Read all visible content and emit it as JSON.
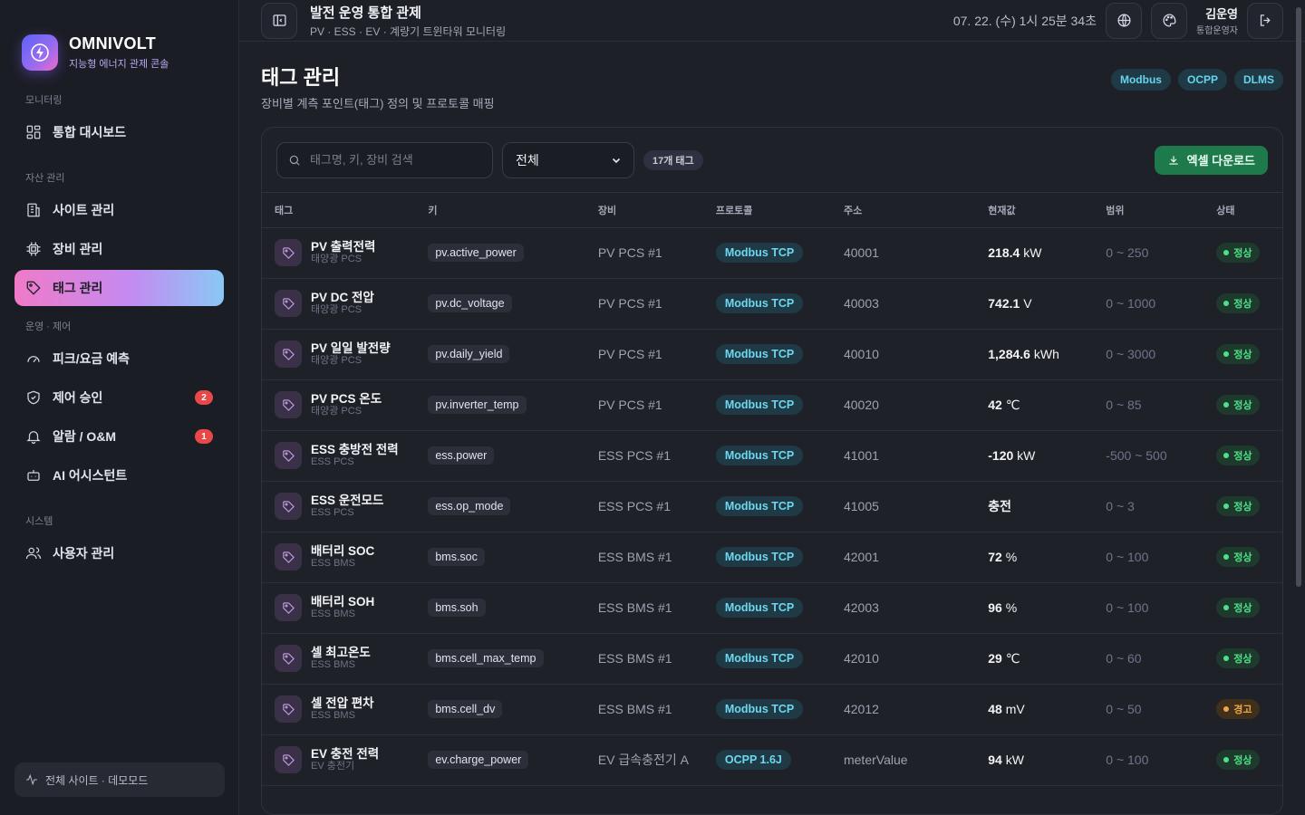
{
  "brand": {
    "name": "OMNIVOLT",
    "subtitle": "지능형 에너지 관제 콘솔"
  },
  "sidebar": {
    "sections": [
      {
        "label": "모니터링"
      },
      {
        "label": "자산 관리"
      },
      {
        "label": "운영 · 제어"
      },
      {
        "label": "시스템"
      }
    ],
    "items": [
      {
        "label": "통합 대시보드",
        "icon": "dashboard-icon"
      },
      {
        "label": "사이트 관리",
        "icon": "building-icon"
      },
      {
        "label": "장비 관리",
        "icon": "chip-icon"
      },
      {
        "label": "태그 관리",
        "icon": "tag-icon",
        "active": true
      },
      {
        "label": "피크/요금 예측",
        "icon": "gauge-icon"
      },
      {
        "label": "제어 승인",
        "icon": "shield-icon",
        "badge": "2"
      },
      {
        "label": "알람 / O&M",
        "icon": "bell-icon",
        "badge": "1"
      },
      {
        "label": "AI 어시스턴트",
        "icon": "robot-icon"
      },
      {
        "label": "사용자 관리",
        "icon": "users-icon"
      }
    ],
    "footer": "전체 사이트 · 데모모드"
  },
  "topbar": {
    "title": "발전 운영 통합 관제",
    "subtitle": "PV · ESS · EV · 계량기 트윈타워 모니터링",
    "clock": "07. 22. (수) 1시 25분 34초",
    "user_name": "김운영",
    "user_role": "통합운영자"
  },
  "page": {
    "title": "태그 관리",
    "subtitle": "장비별 계측 포인트(태그) 정의 및 프로토콜 매핑",
    "protocols": [
      "Modbus",
      "OCPP",
      "DLMS"
    ]
  },
  "toolbar": {
    "search_placeholder": "태그명, 키, 장비 검색",
    "filter_value": "전체",
    "count": "17개 태그",
    "excel_label": "엑셀 다운로드"
  },
  "table": {
    "headers": [
      "태그",
      "키",
      "장비",
      "프로토콜",
      "주소",
      "현재값",
      "범위",
      "상태"
    ],
    "rows": [
      {
        "name": "PV 출력전력",
        "device_type": "태양광 PCS",
        "key": "pv.active_power",
        "device": "PV PCS #1",
        "protocol": "Modbus TCP",
        "address": "40001",
        "value": "218.4",
        "unit": "kW",
        "range": "0 ~ 250",
        "status": "정상",
        "status_level": "ok"
      },
      {
        "name": "PV DC 전압",
        "device_type": "태양광 PCS",
        "key": "pv.dc_voltage",
        "device": "PV PCS #1",
        "protocol": "Modbus TCP",
        "address": "40003",
        "value": "742.1",
        "unit": "V",
        "range": "0 ~ 1000",
        "status": "정상",
        "status_level": "ok"
      },
      {
        "name": "PV 일일 발전량",
        "device_type": "태양광 PCS",
        "key": "pv.daily_yield",
        "device": "PV PCS #1",
        "protocol": "Modbus TCP",
        "address": "40010",
        "value": "1,284.6",
        "unit": "kWh",
        "range": "0 ~ 3000",
        "status": "정상",
        "status_level": "ok"
      },
      {
        "name": "PV PCS 온도",
        "device_type": "태양광 PCS",
        "key": "pv.inverter_temp",
        "device": "PV PCS #1",
        "protocol": "Modbus TCP",
        "address": "40020",
        "value": "42",
        "unit": "℃",
        "range": "0 ~ 85",
        "status": "정상",
        "status_level": "ok"
      },
      {
        "name": "ESS 충방전 전력",
        "device_type": "ESS PCS",
        "key": "ess.power",
        "device": "ESS PCS #1",
        "protocol": "Modbus TCP",
        "address": "41001",
        "value": "-120",
        "unit": "kW",
        "range": "-500 ~ 500",
        "status": "정상",
        "status_level": "ok"
      },
      {
        "name": "ESS 운전모드",
        "device_type": "ESS PCS",
        "key": "ess.op_mode",
        "device": "ESS PCS #1",
        "protocol": "Modbus TCP",
        "address": "41005",
        "value": "충전",
        "unit": "",
        "range": "0 ~ 3",
        "status": "정상",
        "status_level": "ok"
      },
      {
        "name": "배터리 SOC",
        "device_type": "ESS BMS",
        "key": "bms.soc",
        "device": "ESS BMS #1",
        "protocol": "Modbus TCP",
        "address": "42001",
        "value": "72",
        "unit": "%",
        "range": "0 ~ 100",
        "status": "정상",
        "status_level": "ok"
      },
      {
        "name": "배터리 SOH",
        "device_type": "ESS BMS",
        "key": "bms.soh",
        "device": "ESS BMS #1",
        "protocol": "Modbus TCP",
        "address": "42003",
        "value": "96",
        "unit": "%",
        "range": "0 ~ 100",
        "status": "정상",
        "status_level": "ok"
      },
      {
        "name": "셀 최고온도",
        "device_type": "ESS BMS",
        "key": "bms.cell_max_temp",
        "device": "ESS BMS #1",
        "protocol": "Modbus TCP",
        "address": "42010",
        "value": "29",
        "unit": "℃",
        "range": "0 ~ 60",
        "status": "정상",
        "status_level": "ok"
      },
      {
        "name": "셀 전압 편차",
        "device_type": "ESS BMS",
        "key": "bms.cell_dv",
        "device": "ESS BMS #1",
        "protocol": "Modbus TCP",
        "address": "42012",
        "value": "48",
        "unit": "mV",
        "range": "0 ~ 50",
        "status": "경고",
        "status_level": "warn"
      },
      {
        "name": "EV 충전 전력",
        "device_type": "EV 충전기",
        "key": "ev.charge_power",
        "device": "EV 급속충전기 A",
        "protocol": "OCPP 1.6J",
        "address": "meterValue",
        "value": "94",
        "unit": "kW",
        "range": "0 ~ 100",
        "status": "정상",
        "status_level": "ok"
      }
    ]
  }
}
